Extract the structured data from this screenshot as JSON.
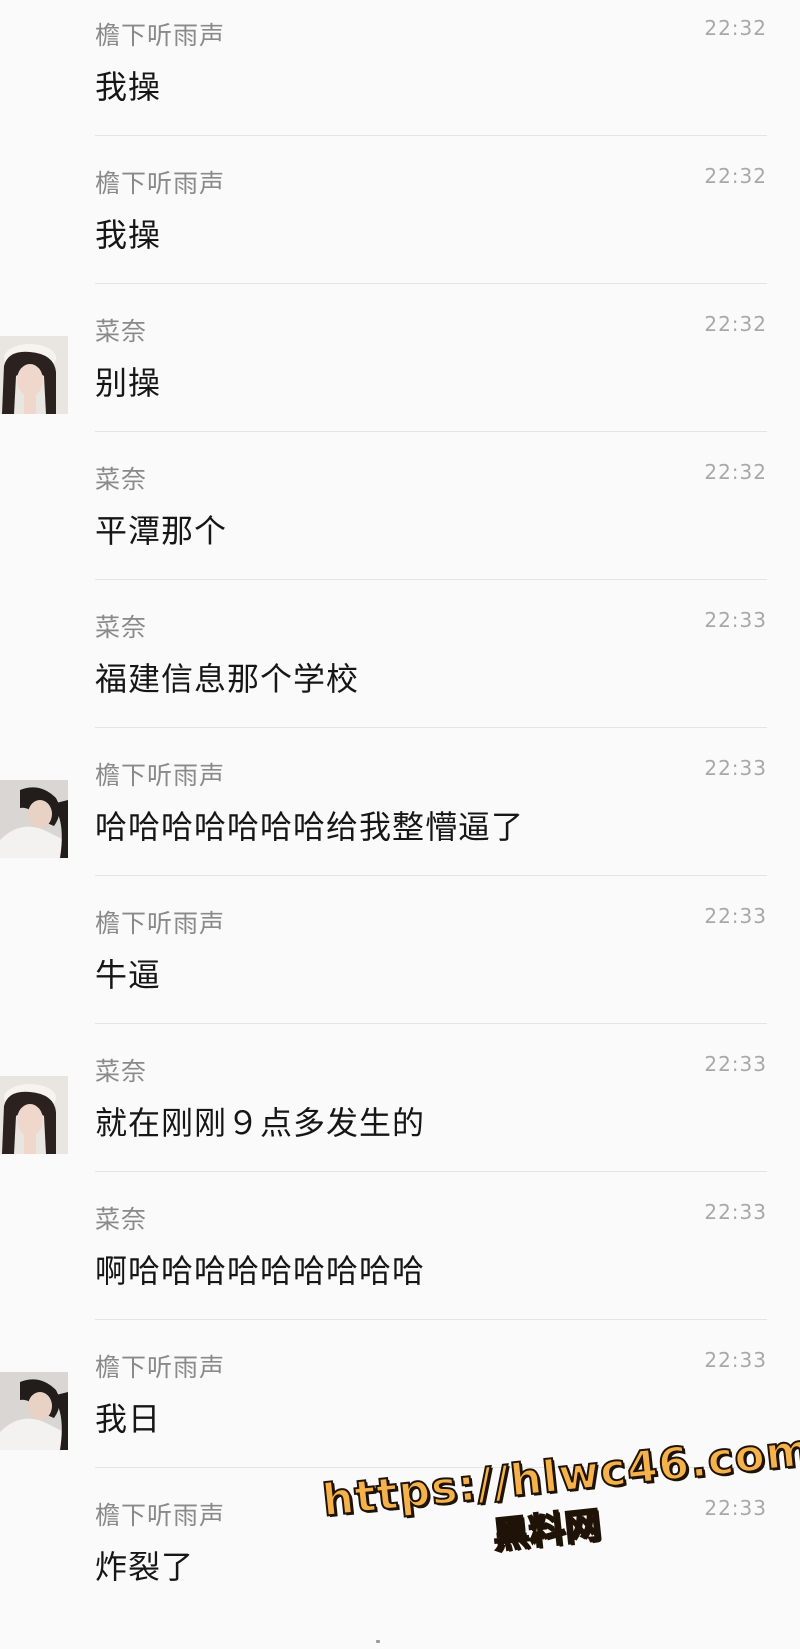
{
  "messages": [
    {
      "sender": "檐下听雨声",
      "time": "22:32",
      "text": "我操",
      "avatar": null
    },
    {
      "sender": "檐下听雨声",
      "time": "22:32",
      "text": "我操",
      "avatar": null
    },
    {
      "sender": "菜奈",
      "time": "22:32",
      "text": "别操",
      "avatar": "cainai-avatar"
    },
    {
      "sender": "菜奈",
      "time": "22:32",
      "text": "平潭那个",
      "avatar": null
    },
    {
      "sender": "菜奈",
      "time": "22:33",
      "text": "福建信息那个学校",
      "avatar": null
    },
    {
      "sender": "檐下听雨声",
      "time": "22:33",
      "text": "哈哈哈哈哈哈哈给我整懵逼了",
      "avatar": "yanxia-avatar"
    },
    {
      "sender": "檐下听雨声",
      "time": "22:33",
      "text": "牛逼",
      "avatar": null
    },
    {
      "sender": "菜奈",
      "time": "22:33",
      "text": "就在刚刚９点多发生的",
      "avatar": "cainai-avatar"
    },
    {
      "sender": "菜奈",
      "time": "22:33",
      "text": "啊哈哈哈哈哈哈哈哈哈",
      "avatar": null
    },
    {
      "sender": "檐下听雨声",
      "time": "22:33",
      "text": "我日",
      "avatar": "yanxia-avatar"
    },
    {
      "sender": "檐下听雨声",
      "time": "22:33",
      "text": "炸裂了",
      "avatar": null
    }
  ],
  "watermark": {
    "url": "https://hlwc46.com",
    "name": "黑料网",
    "color": "#f6b24a"
  }
}
